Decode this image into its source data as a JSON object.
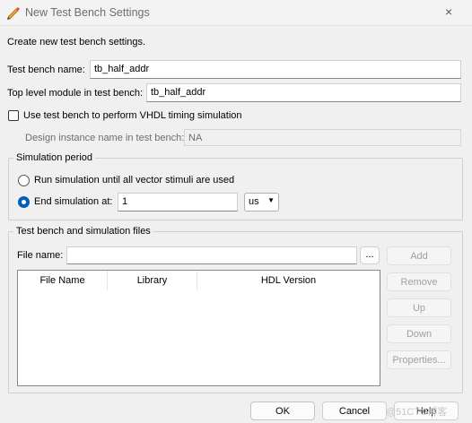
{
  "window": {
    "title": "New Test Bench Settings",
    "close_glyph": "×"
  },
  "intro_text": "Create new test bench settings.",
  "test_bench_name": {
    "label": "Test bench name:",
    "value": "tb_half_addr"
  },
  "top_level_module": {
    "label": "Top level module in test bench:",
    "value": "tb_half_addr"
  },
  "vhdl_timing": {
    "label": "Use test bench to perform VHDL timing simulation",
    "checked": false
  },
  "design_instance": {
    "label": "Design instance name in test bench:",
    "value": "NA"
  },
  "simulation_period": {
    "title": "Simulation period",
    "option_run_all": "Run simulation until all vector stimuli are used",
    "option_end_at": "End simulation at:",
    "selected": "end_at",
    "end_value": "1",
    "unit": "us"
  },
  "files_group": {
    "title": "Test bench and simulation files",
    "file_name_label": "File name:",
    "file_name_value": "",
    "browse_label": "...",
    "columns": [
      "File Name",
      "Library",
      "HDL Version"
    ],
    "rows": [],
    "buttons": {
      "add": "Add",
      "remove": "Remove",
      "up": "Up",
      "down": "Down",
      "properties": "Properties..."
    }
  },
  "footer": {
    "ok": "OK",
    "cancel": "Cancel",
    "help": "Help"
  },
  "watermark": "@51CTO博客"
}
